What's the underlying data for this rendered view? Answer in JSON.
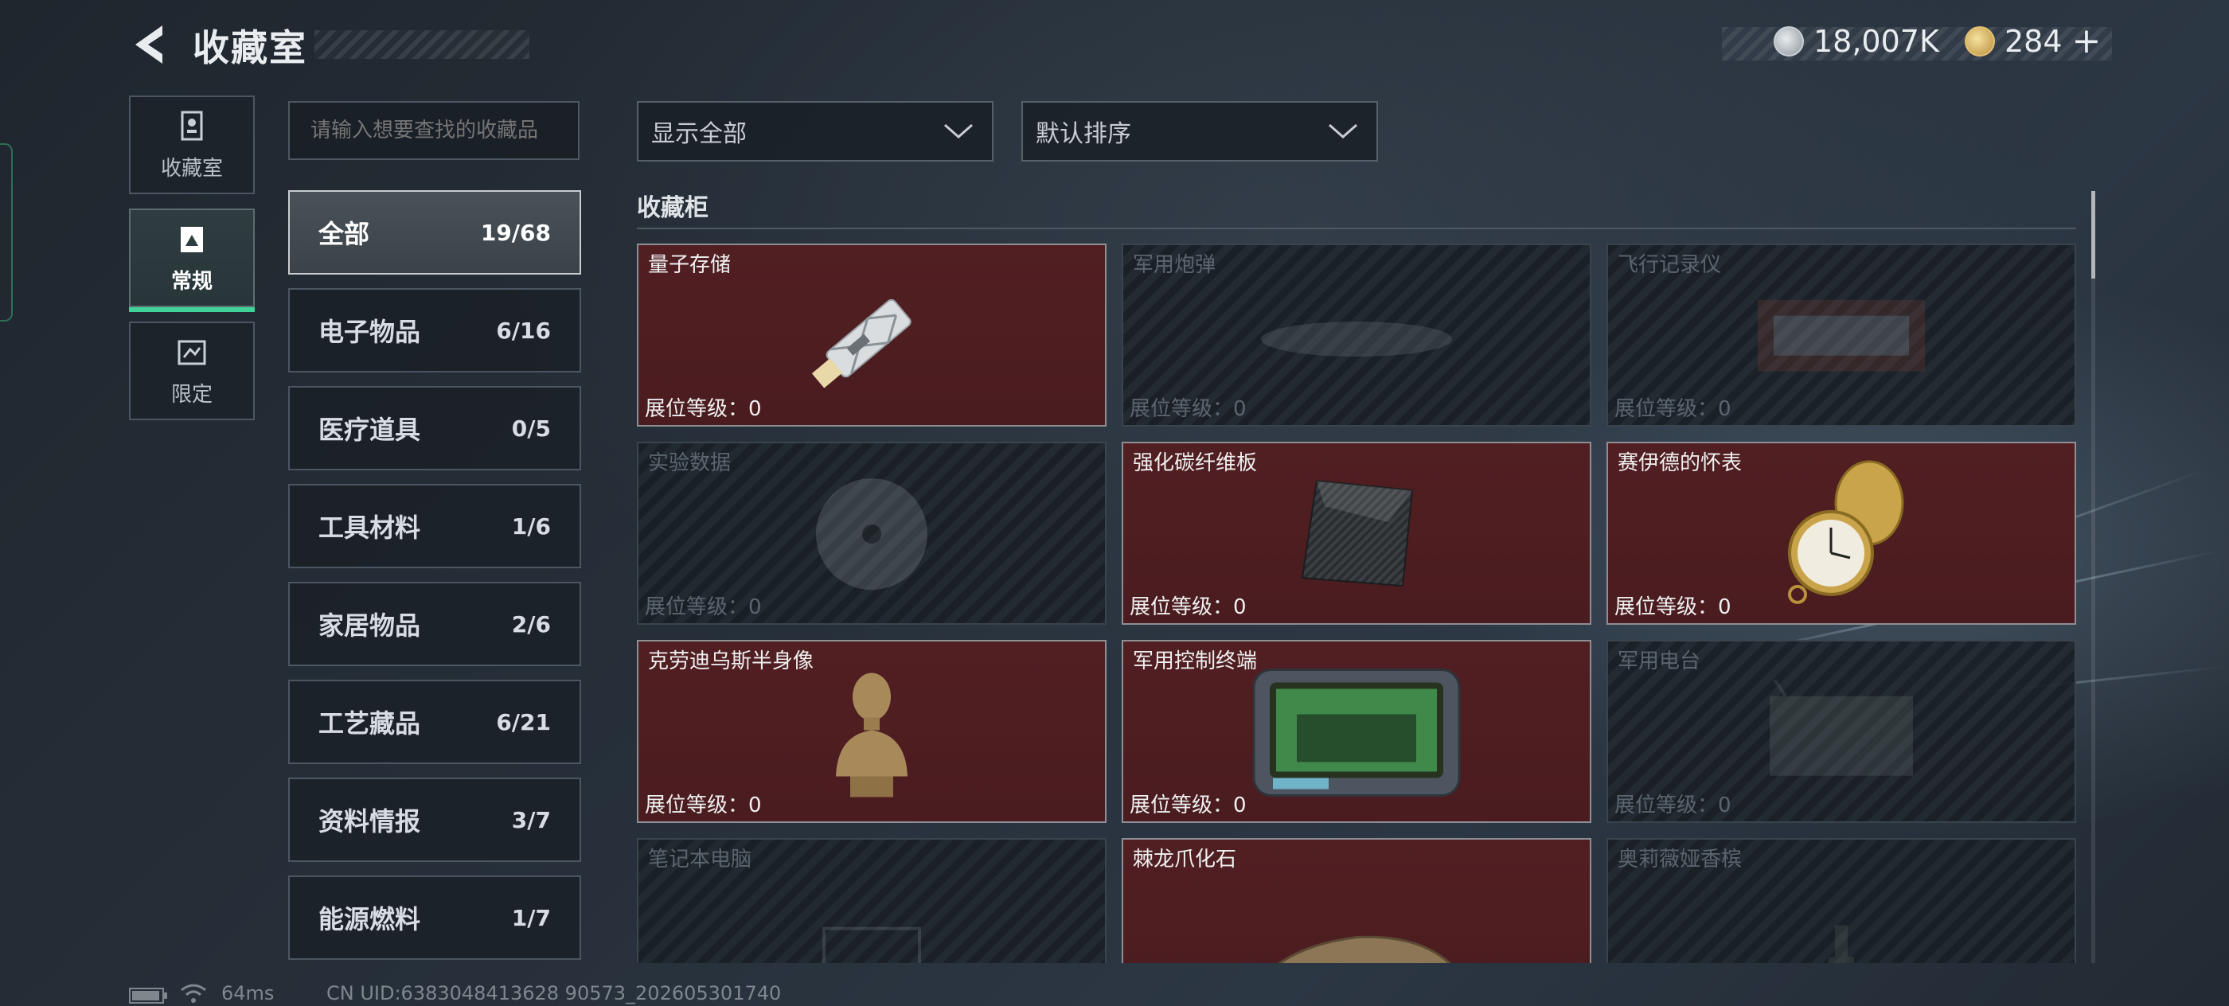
{
  "header": {
    "title": "收藏室"
  },
  "currency": {
    "silver": "18,007K",
    "gold": "284"
  },
  "nav": {
    "tabs": [
      {
        "label": "收藏室"
      },
      {
        "label": "常规"
      },
      {
        "label": "限定"
      }
    ],
    "active": "常规"
  },
  "search": {
    "placeholder": "请输入想要查找的收藏品"
  },
  "categories": [
    {
      "name": "全部",
      "count": "19/68"
    },
    {
      "name": "电子物品",
      "count": "6/16"
    },
    {
      "name": "医疗道具",
      "count": "0/5"
    },
    {
      "name": "工具材料",
      "count": "1/6"
    },
    {
      "name": "家居物品",
      "count": "2/6"
    },
    {
      "name": "工艺藏品",
      "count": "6/21"
    },
    {
      "name": "资料情报",
      "count": "3/7"
    },
    {
      "name": "能源燃料",
      "count": "1/7"
    }
  ],
  "filters": {
    "show": "显示全部",
    "sort": "默认排序"
  },
  "section_title": "收藏柜",
  "level_label": "展位等级：",
  "items": [
    {
      "name": "量子存储",
      "level": "0",
      "collected": true,
      "icon": "usb-drive-icon"
    },
    {
      "name": "军用炮弹",
      "level": "0",
      "collected": false,
      "icon": "shell-icon"
    },
    {
      "name": "飞行记录仪",
      "level": "0",
      "collected": false,
      "icon": "flight-recorder-icon"
    },
    {
      "name": "实验数据",
      "level": "0",
      "collected": false,
      "icon": "disc-icon"
    },
    {
      "name": "强化碳纤维板",
      "level": "0",
      "collected": true,
      "icon": "carbon-plate-icon"
    },
    {
      "name": "赛伊德的怀表",
      "level": "0",
      "collected": true,
      "icon": "pocket-watch-icon"
    },
    {
      "name": "克劳迪乌斯半身像",
      "level": "0",
      "collected": true,
      "icon": "bust-icon"
    },
    {
      "name": "军用控制终端",
      "level": "0",
      "collected": true,
      "icon": "control-terminal-icon"
    },
    {
      "name": "军用电台",
      "level": "0",
      "collected": false,
      "icon": "radio-icon"
    },
    {
      "name": "笔记本电脑",
      "level": "",
      "collected": false,
      "icon": "laptop-icon"
    },
    {
      "name": "棘龙爪化石",
      "level": "",
      "collected": true,
      "icon": "claw-fossil-icon"
    },
    {
      "name": "奥莉薇娅香槟",
      "level": "",
      "collected": false,
      "icon": "champagne-icon"
    }
  ],
  "status": {
    "ping": "64ms",
    "uid": "CN UID:6383048413628 90573_202605301740"
  }
}
